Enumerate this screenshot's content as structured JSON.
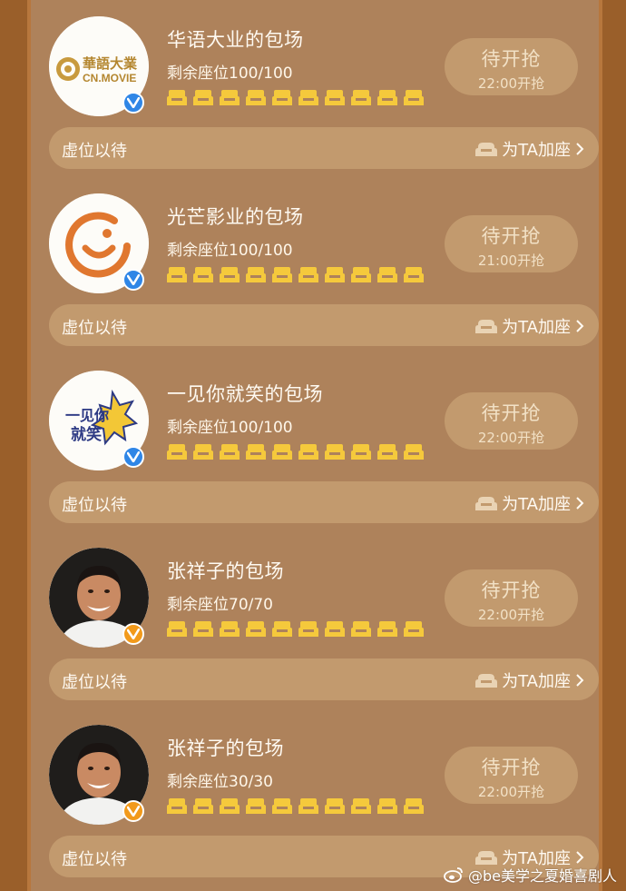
{
  "colors": {
    "background": "#ae825b",
    "button": "#c29a6e",
    "seat": "#f5c93c",
    "verify_blue": "#2f86e6",
    "verify_orange": "#f29a1b"
  },
  "cards": [
    {
      "title": "华语大业的包场",
      "seats_text": "剩余座位100/100",
      "button_main": "待开抢",
      "button_time": "22:00开抢",
      "bar_label": "虚位以待",
      "add_seat_label": "为TA加座",
      "avatar_icon": "cn-movie-logo-icon",
      "avatar_text_1": "華語大業",
      "avatar_text_2": "CN.MOVIE",
      "verify_icon": "verified-blue-icon"
    },
    {
      "title": "光芒影业的包场",
      "seats_text": "剩余座位100/100",
      "button_main": "待开抢",
      "button_time": "21:00开抢",
      "bar_label": "虚位以待",
      "add_seat_label": "为TA加座",
      "avatar_icon": "guangmang-logo-icon",
      "verify_icon": "verified-blue-icon"
    },
    {
      "title": "一见你就笑的包场",
      "seats_text": "剩余座位100/100",
      "button_main": "待开抢",
      "button_time": "22:00开抢",
      "bar_label": "虚位以待",
      "add_seat_label": "为TA加座",
      "avatar_icon": "yijian-logo-icon",
      "avatar_text_1": "一见你",
      "avatar_text_2": "就笑",
      "verify_icon": "verified-blue-icon"
    },
    {
      "title": "张祥子的包场",
      "seats_text": "剩余座位70/70",
      "button_main": "待开抢",
      "button_time": "22:00开抢",
      "bar_label": "虚位以待",
      "add_seat_label": "为TA加座",
      "avatar_icon": "person-photo-icon",
      "verify_icon": "verified-orange-icon"
    },
    {
      "title": "张祥子的包场",
      "seats_text": "剩余座位30/30",
      "button_main": "待开抢",
      "button_time": "22:00开抢",
      "bar_label": "虚位以待",
      "add_seat_label": "为TA加座",
      "avatar_icon": "person-photo-icon",
      "verify_icon": "verified-orange-icon"
    }
  ],
  "watermark": "@be美学之夏婚喜剧人"
}
